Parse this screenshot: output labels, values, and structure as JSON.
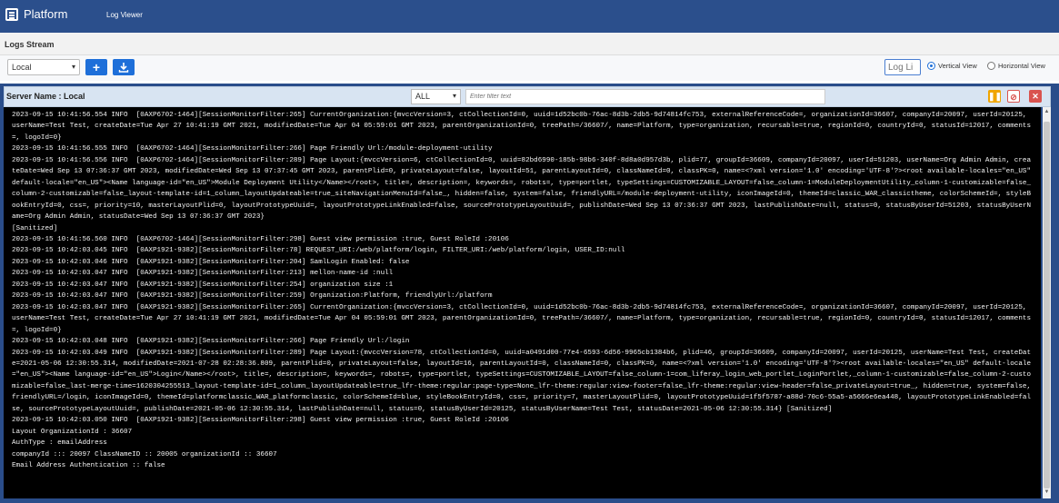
{
  "nav": {
    "brand": "Platform",
    "link_log_viewer": "Log Viewer"
  },
  "header": {
    "title": "Logs Stream"
  },
  "toolbar": {
    "environment_value": "Local",
    "add_label": "+",
    "download_icon": "download-icon",
    "log_input_placeholder": "Log Li",
    "view_vertical": "Vertical View",
    "view_horizontal": "Horizontal View",
    "selected_view": "Vertical View"
  },
  "panel": {
    "server_name": "Server Name : Local",
    "level_value": "ALL",
    "filter_placeholder": "Enter filter text",
    "pause_icon": "pause-icon",
    "clear_icon": "ban-icon",
    "close_icon": "close-icon"
  },
  "colors": {
    "nav": "#2b4f8c",
    "accent": "#1e6fd9",
    "pause": "#f0a500",
    "danger": "#d9534f"
  },
  "log_lines": [
    "2023-09-15 10:41:56.554 INFO  [0AXP6702-1464][SessionMonitorFilter:265] CurrentOrganization:{mvccVersion=3, ctCollectionId=0, uuid=1d52bc0b-76ac-8d3b-2db5-9d74814fc753, externalReferenceCode=, organizationId=36607, companyId=20097, userId=20125, userName=Test Test, createDate=Tue Apr 27 10:41:19 GMT 2021, modifiedDate=Tue Apr 04 05:59:01 GMT 2023, parentOrganizationId=0, treePath=/36607/, name=Platform, type=organization, recursable=true, regionId=0, countryId=0, statusId=12017, comments=, logoId=0}",
    "2023-09-15 10:41:56.555 INFO  [0AXP6702-1464][SessionMonitorFilter:266] Page Friendly Url:/module-deployment-utility",
    "2023-09-15 10:41:56.556 INFO  [0AXP6702-1464][SessionMonitorFilter:289] Page Layout:{mvccVersion=6, ctCollectionId=0, uuid=82bd6990-185b-98b6-340f-8d8a0d957d3b, plid=77, groupId=36609, companyId=20097, userId=51203, userName=Org Admin Admin, createDate=Wed Sep 13 07:36:37 GMT 2023, modifiedDate=Wed Sep 13 07:37:45 GMT 2023, parentPlid=0, privateLayout=false, layoutId=51, parentLayoutId=0, classNameId=0, classPK=0, name=<?xml version='1.0' encoding='UTF-8'?><root available-locales=\"en_US\" default-locale=\"en_US\"><Name language-id=\"en_US\">Module Deployment Utility</Name></root>, title=, description=, keywords=, robots=, type=portlet, typeSettings=CUSTOMIZABLE_LAYOUT=false_column-1=ModuleDeploymentUtility_column-1-customizable=false_column-2-customizable=false_layout-template-id=1_column_layoutUpdateable=true_siteNavigationMenuId=false_, hidden=false, system=false, friendlyURL=/module-deployment-utility, iconImageId=0, themeId=classic_WAR_classictheme, colorSchemeId=, styleBookEntryId=0, css=, priority=10, masterLayoutPlid=0, layoutPrototypeUuid=, layoutPrototypeLinkEnabled=false, sourcePrototypeLayoutUuid=, publishDate=Wed Sep 13 07:36:37 GMT 2023, lastPublishDate=null, status=0, statusByUserId=51203, statusByUserName=Org Admin Admin, statusDate=Wed Sep 13 07:36:37 GMT 2023}",
    "[Sanitized]",
    "2023-09-15 10:41:56.560 INFO  [0AXP6702-1464][SessionMonitorFilter:298] Guest view permission :true, Guest RoleId :20106",
    "2023-09-15 10:42:03.045 INFO  [0AXP1921-9382][SessionMonitorFilter:78] REQUEST_URI:/web/platform/login, FILTER_URI:/web/platform/login, USER_ID:null",
    "2023-09-15 10:42:03.046 INFO  [0AXP1921-9382][SessionMonitorFilter:204] SamlLogin Enabled: false",
    "2023-09-15 10:42:03.047 INFO  [0AXP1921-9382][SessionMonitorFilter:213] mellon-name-id :null",
    "2023-09-15 10:42:03.047 INFO  [0AXP1921-9382][SessionMonitorFilter:254] organization size :1",
    "2023-09-15 10:42:03.047 INFO  [0AXP1921-9382][SessionMonitorFilter:259] Organization:Platform, friendlyUrl:/platform",
    "2023-09-15 10:42:03.047 INFO  [0AXP1921-9382][SessionMonitorFilter:265] CurrentOrganization:{mvccVersion=3, ctCollectionId=0, uuid=1d52bc0b-76ac-8d3b-2db5-9d74814fc753, externalReferenceCode=, organizationId=36607, companyId=20097, userId=20125, userName=Test Test, createDate=Tue Apr 27 10:41:19 GMT 2021, modifiedDate=Tue Apr 04 05:59:01 GMT 2023, parentOrganizationId=0, treePath=/36607/, name=Platform, type=organization, recursable=true, regionId=0, countryId=0, statusId=12017, comments=, logoId=0}",
    "2023-09-15 10:42:03.048 INFO  [0AXP1921-9382][SessionMonitorFilter:266] Page Friendly Url:/login",
    "2023-09-15 10:42:03.049 INFO  [0AXP1921-9382][SessionMonitorFilter:289] Page Layout:{mvccVersion=78, ctCollectionId=0, uuid=a0491d00-77e4-6593-6d56-9965cb1384b6, plid=46, groupId=36609, companyId=20097, userId=20125, userName=Test Test, createDate=2021-05-06 12:30:55.314, modifiedDate=2021-07-28 02:28:36.809, parentPlid=0, privateLayout=false, layoutId=16, parentLayoutId=0, classNameId=0, classPK=0, name=<?xml version='1.0' encoding='UTF-8'?><root available-locales=\"en_US\" default-locale=\"en_US\"><Name language-id=\"en_US\">Login</Name></root>, title=, description=, keywords=, robots=, type=portlet, typeSettings=CUSTOMIZABLE_LAYOUT=false_column-1=com_liferay_login_web_portlet_LoginPortlet,_column-1-customizable=false_column-2-customizable=false_last-merge-time=1620304255513_layout-template-id=1_column_layoutUpdateable=true_lfr-theme:regular:page-type=None_lfr-theme:regular:view-footer=false_lfr-theme:regular:view-header=false_privateLayout=true_, hidden=true, system=false, friendlyURL=/login, iconImageId=0, themeId=platformclassic_WAR_platformclassic, colorSchemeId=blue, styleBookEntryId=0, css=, priority=7, masterLayoutPlid=0, layoutPrototypeUuid=1f5f5787-a88d-70c6-55a5-a5666e6ea448, layoutPrototypeLinkEnabled=false, sourcePrototypeLayoutUuid=, publishDate=2021-05-06 12:30:55.314, lastPublishDate=null, status=0, statusByUserId=20125, statusByUserName=Test Test, statusDate=2021-05-06 12:30:55.314} [Sanitized]",
    "2023-09-15 10:42:03.050 INFO  [0AXP1921-9382][SessionMonitorFilter:298] Guest view permission :true, Guest RoleId :20106",
    "Layout OrganizationId : 36607",
    "AuthType : emailAddress",
    "companyId ::: 20097 ClassNameID :: 20005 organizationId :: 36607",
    "Email Address Authentication :: false"
  ]
}
